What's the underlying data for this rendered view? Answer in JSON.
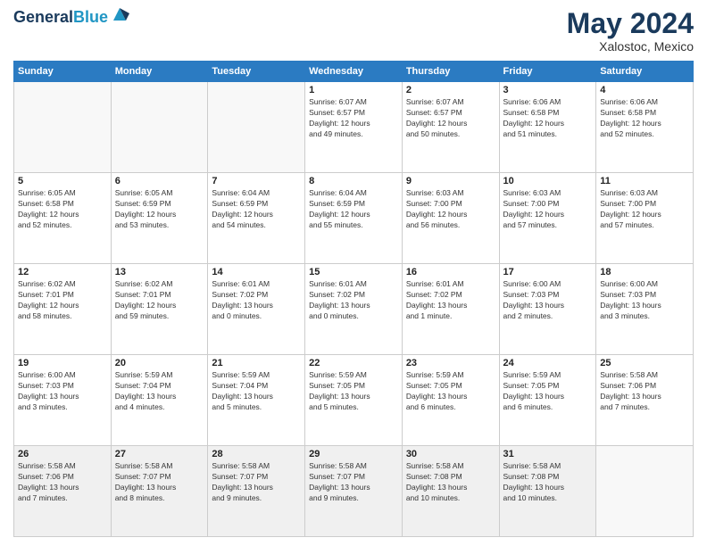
{
  "header": {
    "logo_line1": "General",
    "logo_line2": "Blue",
    "month": "May 2024",
    "location": "Xalostoc, Mexico"
  },
  "weekdays": [
    "Sunday",
    "Monday",
    "Tuesday",
    "Wednesday",
    "Thursday",
    "Friday",
    "Saturday"
  ],
  "weeks": [
    [
      {
        "day": "",
        "info": ""
      },
      {
        "day": "",
        "info": ""
      },
      {
        "day": "",
        "info": ""
      },
      {
        "day": "1",
        "info": "Sunrise: 6:07 AM\nSunset: 6:57 PM\nDaylight: 12 hours\nand 49 minutes."
      },
      {
        "day": "2",
        "info": "Sunrise: 6:07 AM\nSunset: 6:57 PM\nDaylight: 12 hours\nand 50 minutes."
      },
      {
        "day": "3",
        "info": "Sunrise: 6:06 AM\nSunset: 6:58 PM\nDaylight: 12 hours\nand 51 minutes."
      },
      {
        "day": "4",
        "info": "Sunrise: 6:06 AM\nSunset: 6:58 PM\nDaylight: 12 hours\nand 52 minutes."
      }
    ],
    [
      {
        "day": "5",
        "info": "Sunrise: 6:05 AM\nSunset: 6:58 PM\nDaylight: 12 hours\nand 52 minutes."
      },
      {
        "day": "6",
        "info": "Sunrise: 6:05 AM\nSunset: 6:59 PM\nDaylight: 12 hours\nand 53 minutes."
      },
      {
        "day": "7",
        "info": "Sunrise: 6:04 AM\nSunset: 6:59 PM\nDaylight: 12 hours\nand 54 minutes."
      },
      {
        "day": "8",
        "info": "Sunrise: 6:04 AM\nSunset: 6:59 PM\nDaylight: 12 hours\nand 55 minutes."
      },
      {
        "day": "9",
        "info": "Sunrise: 6:03 AM\nSunset: 7:00 PM\nDaylight: 12 hours\nand 56 minutes."
      },
      {
        "day": "10",
        "info": "Sunrise: 6:03 AM\nSunset: 7:00 PM\nDaylight: 12 hours\nand 57 minutes."
      },
      {
        "day": "11",
        "info": "Sunrise: 6:03 AM\nSunset: 7:00 PM\nDaylight: 12 hours\nand 57 minutes."
      }
    ],
    [
      {
        "day": "12",
        "info": "Sunrise: 6:02 AM\nSunset: 7:01 PM\nDaylight: 12 hours\nand 58 minutes."
      },
      {
        "day": "13",
        "info": "Sunrise: 6:02 AM\nSunset: 7:01 PM\nDaylight: 12 hours\nand 59 minutes."
      },
      {
        "day": "14",
        "info": "Sunrise: 6:01 AM\nSunset: 7:02 PM\nDaylight: 13 hours\nand 0 minutes."
      },
      {
        "day": "15",
        "info": "Sunrise: 6:01 AM\nSunset: 7:02 PM\nDaylight: 13 hours\nand 0 minutes."
      },
      {
        "day": "16",
        "info": "Sunrise: 6:01 AM\nSunset: 7:02 PM\nDaylight: 13 hours\nand 1 minute."
      },
      {
        "day": "17",
        "info": "Sunrise: 6:00 AM\nSunset: 7:03 PM\nDaylight: 13 hours\nand 2 minutes."
      },
      {
        "day": "18",
        "info": "Sunrise: 6:00 AM\nSunset: 7:03 PM\nDaylight: 13 hours\nand 3 minutes."
      }
    ],
    [
      {
        "day": "19",
        "info": "Sunrise: 6:00 AM\nSunset: 7:03 PM\nDaylight: 13 hours\nand 3 minutes."
      },
      {
        "day": "20",
        "info": "Sunrise: 5:59 AM\nSunset: 7:04 PM\nDaylight: 13 hours\nand 4 minutes."
      },
      {
        "day": "21",
        "info": "Sunrise: 5:59 AM\nSunset: 7:04 PM\nDaylight: 13 hours\nand 5 minutes."
      },
      {
        "day": "22",
        "info": "Sunrise: 5:59 AM\nSunset: 7:05 PM\nDaylight: 13 hours\nand 5 minutes."
      },
      {
        "day": "23",
        "info": "Sunrise: 5:59 AM\nSunset: 7:05 PM\nDaylight: 13 hours\nand 6 minutes."
      },
      {
        "day": "24",
        "info": "Sunrise: 5:59 AM\nSunset: 7:05 PM\nDaylight: 13 hours\nand 6 minutes."
      },
      {
        "day": "25",
        "info": "Sunrise: 5:58 AM\nSunset: 7:06 PM\nDaylight: 13 hours\nand 7 minutes."
      }
    ],
    [
      {
        "day": "26",
        "info": "Sunrise: 5:58 AM\nSunset: 7:06 PM\nDaylight: 13 hours\nand 7 minutes."
      },
      {
        "day": "27",
        "info": "Sunrise: 5:58 AM\nSunset: 7:07 PM\nDaylight: 13 hours\nand 8 minutes."
      },
      {
        "day": "28",
        "info": "Sunrise: 5:58 AM\nSunset: 7:07 PM\nDaylight: 13 hours\nand 9 minutes."
      },
      {
        "day": "29",
        "info": "Sunrise: 5:58 AM\nSunset: 7:07 PM\nDaylight: 13 hours\nand 9 minutes."
      },
      {
        "day": "30",
        "info": "Sunrise: 5:58 AM\nSunset: 7:08 PM\nDaylight: 13 hours\nand 10 minutes."
      },
      {
        "day": "31",
        "info": "Sunrise: 5:58 AM\nSunset: 7:08 PM\nDaylight: 13 hours\nand 10 minutes."
      },
      {
        "day": "",
        "info": ""
      }
    ]
  ]
}
